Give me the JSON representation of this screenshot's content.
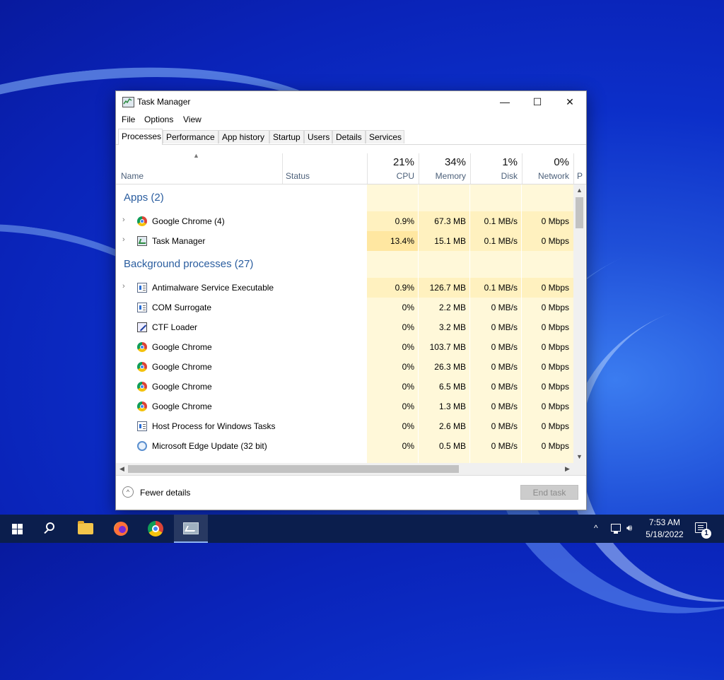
{
  "window": {
    "title": "Task Manager",
    "controls": {
      "minimize": "—",
      "maximize": "☐",
      "close": "✕"
    }
  },
  "menu": [
    "File",
    "Options",
    "View"
  ],
  "tabs": [
    "Processes",
    "Performance",
    "App history",
    "Startup",
    "Users",
    "Details",
    "Services"
  ],
  "active_tab": "Processes",
  "header": {
    "name_label": "Name",
    "status_label": "Status",
    "cpu_pct": "21%",
    "cpu_label": "CPU",
    "memory_pct": "34%",
    "memory_label": "Memory",
    "disk_pct": "1%",
    "disk_label": "Disk",
    "network_pct": "0%",
    "network_label": "Network",
    "power_partial": "P"
  },
  "groups": {
    "apps": "Apps (2)",
    "background": "Background processes (27)"
  },
  "apps": [
    {
      "name": "Google Chrome (4)",
      "icon": "chrome-icon",
      "expandable": true,
      "cpu": "0.9%",
      "memory": "67.3 MB",
      "disk": "0.1 MB/s",
      "network": "0 Mbps"
    },
    {
      "name": "Task Manager",
      "icon": "task-manager-icon",
      "expandable": true,
      "cpu": "13.4%",
      "memory": "15.1 MB",
      "disk": "0.1 MB/s",
      "network": "0 Mbps"
    }
  ],
  "background": [
    {
      "name": "Antimalware Service Executable",
      "icon": "service-icon",
      "expandable": true,
      "cpu": "0.9%",
      "memory": "126.7 MB",
      "disk": "0.1 MB/s",
      "network": "0 Mbps"
    },
    {
      "name": "COM Surrogate",
      "icon": "service-icon",
      "expandable": false,
      "cpu": "0%",
      "memory": "2.2 MB",
      "disk": "0 MB/s",
      "network": "0 Mbps"
    },
    {
      "name": "CTF Loader",
      "icon": "ctf-icon",
      "expandable": false,
      "cpu": "0%",
      "memory": "3.2 MB",
      "disk": "0 MB/s",
      "network": "0 Mbps"
    },
    {
      "name": "Google Chrome",
      "icon": "chrome-icon",
      "expandable": false,
      "cpu": "0%",
      "memory": "103.7 MB",
      "disk": "0 MB/s",
      "network": "0 Mbps"
    },
    {
      "name": "Google Chrome",
      "icon": "chrome-icon",
      "expandable": false,
      "cpu": "0%",
      "memory": "26.3 MB",
      "disk": "0 MB/s",
      "network": "0 Mbps"
    },
    {
      "name": "Google Chrome",
      "icon": "chrome-icon",
      "expandable": false,
      "cpu": "0%",
      "memory": "6.5 MB",
      "disk": "0 MB/s",
      "network": "0 Mbps"
    },
    {
      "name": "Google Chrome",
      "icon": "chrome-icon",
      "expandable": false,
      "cpu": "0%",
      "memory": "1.3 MB",
      "disk": "0 MB/s",
      "network": "0 Mbps"
    },
    {
      "name": "Host Process for Windows Tasks",
      "icon": "service-icon",
      "expandable": false,
      "cpu": "0%",
      "memory": "2.6 MB",
      "disk": "0 MB/s",
      "network": "0 Mbps"
    },
    {
      "name": "Microsoft Edge Update (32 bit)",
      "icon": "edge-update-icon",
      "expandable": false,
      "cpu": "0%",
      "memory": "0.5 MB",
      "disk": "0 MB/s",
      "network": "0 Mbps"
    }
  ],
  "footer": {
    "fewer_details": "Fewer details",
    "end_task": "End task"
  },
  "taskbar": {
    "apps": [
      "start-icon",
      "search-icon",
      "file-explorer-icon",
      "firefox-icon",
      "chrome-icon",
      "task-manager-icon"
    ],
    "time": "7:53 AM",
    "date": "5/18/2022",
    "notifications": "1"
  },
  "colors": {
    "heat_low": "#fff8d9",
    "heat_mid": "#fff1bf",
    "heat_high": "#ffe7a1",
    "group_text": "#2a5d9f",
    "taskbar": "#0b1e4d"
  }
}
